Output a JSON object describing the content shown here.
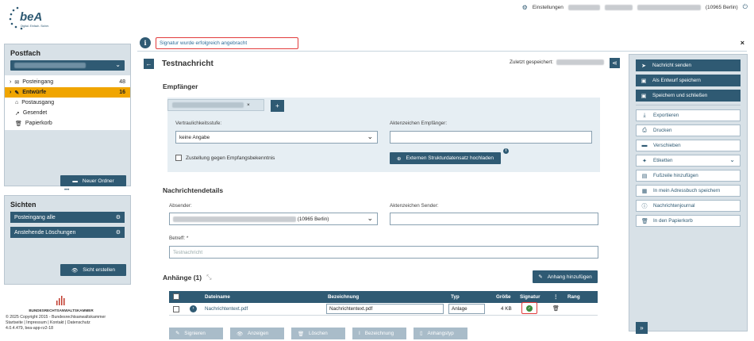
{
  "brand": {
    "logo_text": "beA",
    "logo_subtext": "Digital. Einfach. Sicher."
  },
  "topbar": {
    "settings_label": "Einstellungen",
    "location": "(10965 Berlin)"
  },
  "postfach": {
    "heading": "Postfach",
    "folders": [
      {
        "label": "Posteingang",
        "count": "48",
        "icon": "inbox-icon"
      },
      {
        "label": "Entwürfe",
        "count": "16",
        "icon": "drafts-icon"
      },
      {
        "label": "Postausgang",
        "count": "",
        "icon": "outbox-icon"
      },
      {
        "label": "Gesendet",
        "count": "",
        "icon": "sent-icon"
      },
      {
        "label": "Papierkorb",
        "count": "",
        "icon": "trash-icon"
      }
    ],
    "new_folder_label": "Neuer Ordner"
  },
  "sichten": {
    "heading": "Sichten",
    "items": [
      {
        "label": "Posteingang alle"
      },
      {
        "label": "Anstehende Löschungen"
      }
    ],
    "create_label": "Sicht erstellen"
  },
  "footer": {
    "org": "BUNDESRECHTSANWALTSKAMMER",
    "copyright": "© 2025 Copyright 2015 - Bundesrechtsanwaltskammer",
    "links": "Startseite | Impressum | Kontakt | Datenschutz",
    "version": "4.0.4.479, bea-app-rz2-18"
  },
  "notification": {
    "message": "Signatur wurde erfolgreich angebracht",
    "close": "×"
  },
  "message": {
    "title": "Testnachricht",
    "saved_label": "Zuletzt gespeichert:",
    "recipients_heading": "Empfänger",
    "chip_close": "×",
    "add_label": "+",
    "confidentiality_label": "Vertraulichkeitsstufe:",
    "confidentiality_value": "keine Angabe",
    "recipient_ref_label": "Aktenzeichen Empfänger:",
    "receipt_label": "Zustellung gegen Empfangsbekenntnis",
    "upload_label": "Externen Strukturdatensatz hochladen",
    "details_heading": "Nachrichtendetails",
    "sender_label": "Absender:",
    "sender_suffix": "(10965 Berlin)",
    "sender_ref_label": "Aktenzeichen Sender:",
    "subject_label": "Betreff: *",
    "subject_placeholder": "Testnachricht",
    "attachments_heading": "Anhänge (1)",
    "add_attachment_label": "Anhang hinzufügen",
    "table": {
      "headers": [
        "Dateiname",
        "Bezeichnung",
        "Typ",
        "Größe",
        "Signatur",
        "⋮",
        "Rang"
      ],
      "rows": [
        {
          "filename": "Nachrichtentext.pdf",
          "designation": "Nachrichtentext.pdf",
          "type": "Anlage",
          "size": "4 KB"
        }
      ]
    },
    "bottom_actions": [
      "Signieren",
      "Anzeigen",
      "Löschen",
      "Bezeichnung",
      "Anhangstyp"
    ]
  },
  "actions": {
    "primary": [
      "Nachricht senden",
      "Als Entwurf speichern",
      "Speichern und schließen"
    ],
    "secondary": [
      "Exportieren",
      "Drucken",
      "Verschieben",
      "Etiketten",
      "Fußzeile hinzufügen",
      "In mein Adressbuch speichern",
      "Nachrichtenjournal",
      "In den Papierkorb"
    ],
    "collapse": "»"
  },
  "colors": {
    "primary": "#2f5a73",
    "selected": "#f0a500",
    "panel": "#d8e1e7",
    "highlight_border": "#e23b3b",
    "success": "#3c8a3c"
  }
}
